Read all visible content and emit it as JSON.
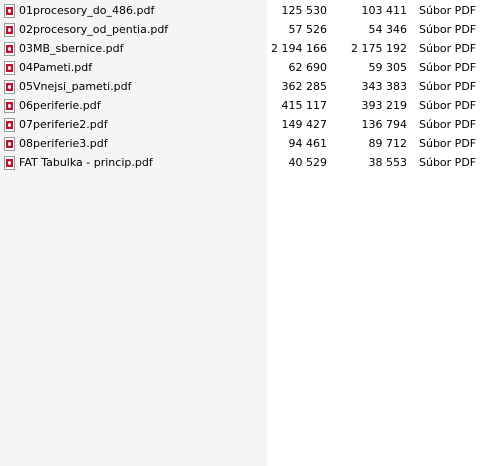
{
  "files": [
    {
      "name": "01procesory_do_486.pdf",
      "size": "125 530",
      "packed": "103 411",
      "type": "Súbor PDF",
      "icon": "pdf-file-icon"
    },
    {
      "name": "02procesory_od_pentia.pdf",
      "size": "57 526",
      "packed": "54 346",
      "type": "Súbor PDF",
      "icon": "pdf-file-icon"
    },
    {
      "name": "03MB_sbernice.pdf",
      "size": "2 194 166",
      "packed": "2 175 192",
      "type": "Súbor PDF",
      "icon": "pdf-file-icon"
    },
    {
      "name": "04Pameti.pdf",
      "size": "62 690",
      "packed": "59 305",
      "type": "Súbor PDF",
      "icon": "pdf-file-icon"
    },
    {
      "name": "05Vnejsi_pameti.pdf",
      "size": "362 285",
      "packed": "343 383",
      "type": "Súbor PDF",
      "icon": "pdf-file-icon"
    },
    {
      "name": "06periferie.pdf",
      "size": "415 117",
      "packed": "393 219",
      "type": "Súbor PDF",
      "icon": "pdf-file-icon"
    },
    {
      "name": "07periferie2.pdf",
      "size": "149 427",
      "packed": "136 794",
      "type": "Súbor PDF",
      "icon": "pdf-file-icon"
    },
    {
      "name": "08periferie3.pdf",
      "size": "94 461",
      "packed": "89 712",
      "type": "Súbor PDF",
      "icon": "pdf-file-icon"
    },
    {
      "name": "FAT Tabulka - princip.pdf",
      "size": "40 529",
      "packed": "38 553",
      "type": "Súbor PDF",
      "icon": "pdf-file-icon"
    }
  ]
}
